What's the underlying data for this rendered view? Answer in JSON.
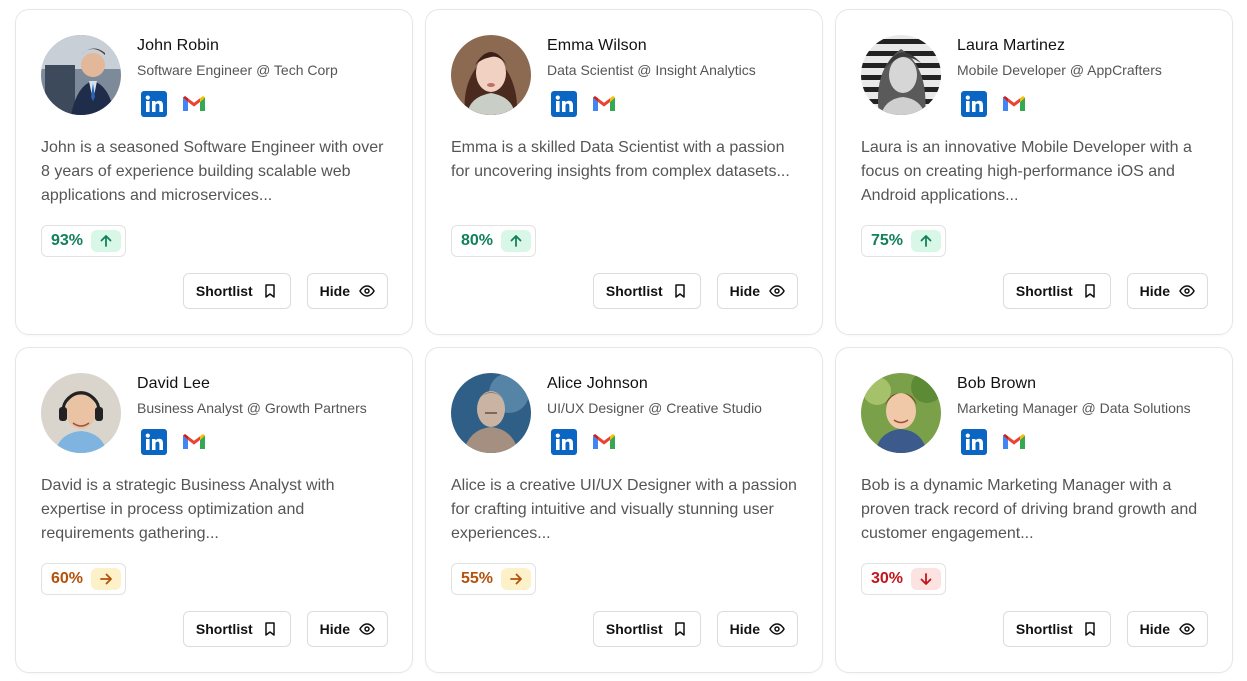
{
  "buttons": {
    "shortlist": "Shortlist",
    "hide": "Hide"
  },
  "colors": {
    "up_text": "#12805c",
    "up_bg": "#d9f7e6",
    "flat_text": "#b4510a",
    "flat_bg": "#fdf1c9",
    "down_text": "#c2151b",
    "down_bg": "#fde2e2",
    "linkedin": "#0a66c2"
  },
  "candidates": [
    {
      "name": "John Robin",
      "role": "Software Engineer @ Tech Corp",
      "bio": "John is a seasoned Software Engineer with over 8 years of experience building scalable web applications and microservices...",
      "score": "93%",
      "trend": "up",
      "avatar_icon": "man-in-suit-photo"
    },
    {
      "name": "Emma Wilson",
      "role": "Data Scientist @ Insight Analytics",
      "bio": "Emma is a skilled Data Scientist with a passion for uncovering insights from complex datasets...",
      "score": "80%",
      "trend": "up",
      "avatar_icon": "woman-scarf-photo"
    },
    {
      "name": "Laura Martinez",
      "role": "Mobile Developer @ AppCrafters",
      "bio": "Laura is an innovative Mobile Developer with a focus on creating high-performance iOS and Android applications...",
      "score": "75%",
      "trend": "up",
      "avatar_icon": "woman-bw-photo"
    },
    {
      "name": "David Lee",
      "role": "Business Analyst @ Growth Partners",
      "bio": "David is a strategic Business Analyst with expertise in process optimization and requirements gathering...",
      "score": "60%",
      "trend": "flat",
      "avatar_icon": "man-headphones-photo"
    },
    {
      "name": "Alice Johnson",
      "role": "UI/UX Designer @ Creative Studio",
      "bio": "Alice is a creative UI/UX Designer with a passion for crafting intuitive and visually stunning user experiences...",
      "score": "55%",
      "trend": "flat",
      "avatar_icon": "man-blue-photo"
    },
    {
      "name": "Bob Brown",
      "role": "Marketing Manager @ Data Solutions",
      "bio": "Bob is a dynamic Marketing Manager with a proven track record of driving brand growth and customer engagement...",
      "score": "30%",
      "trend": "down",
      "avatar_icon": "boy-outdoor-photo"
    }
  ]
}
